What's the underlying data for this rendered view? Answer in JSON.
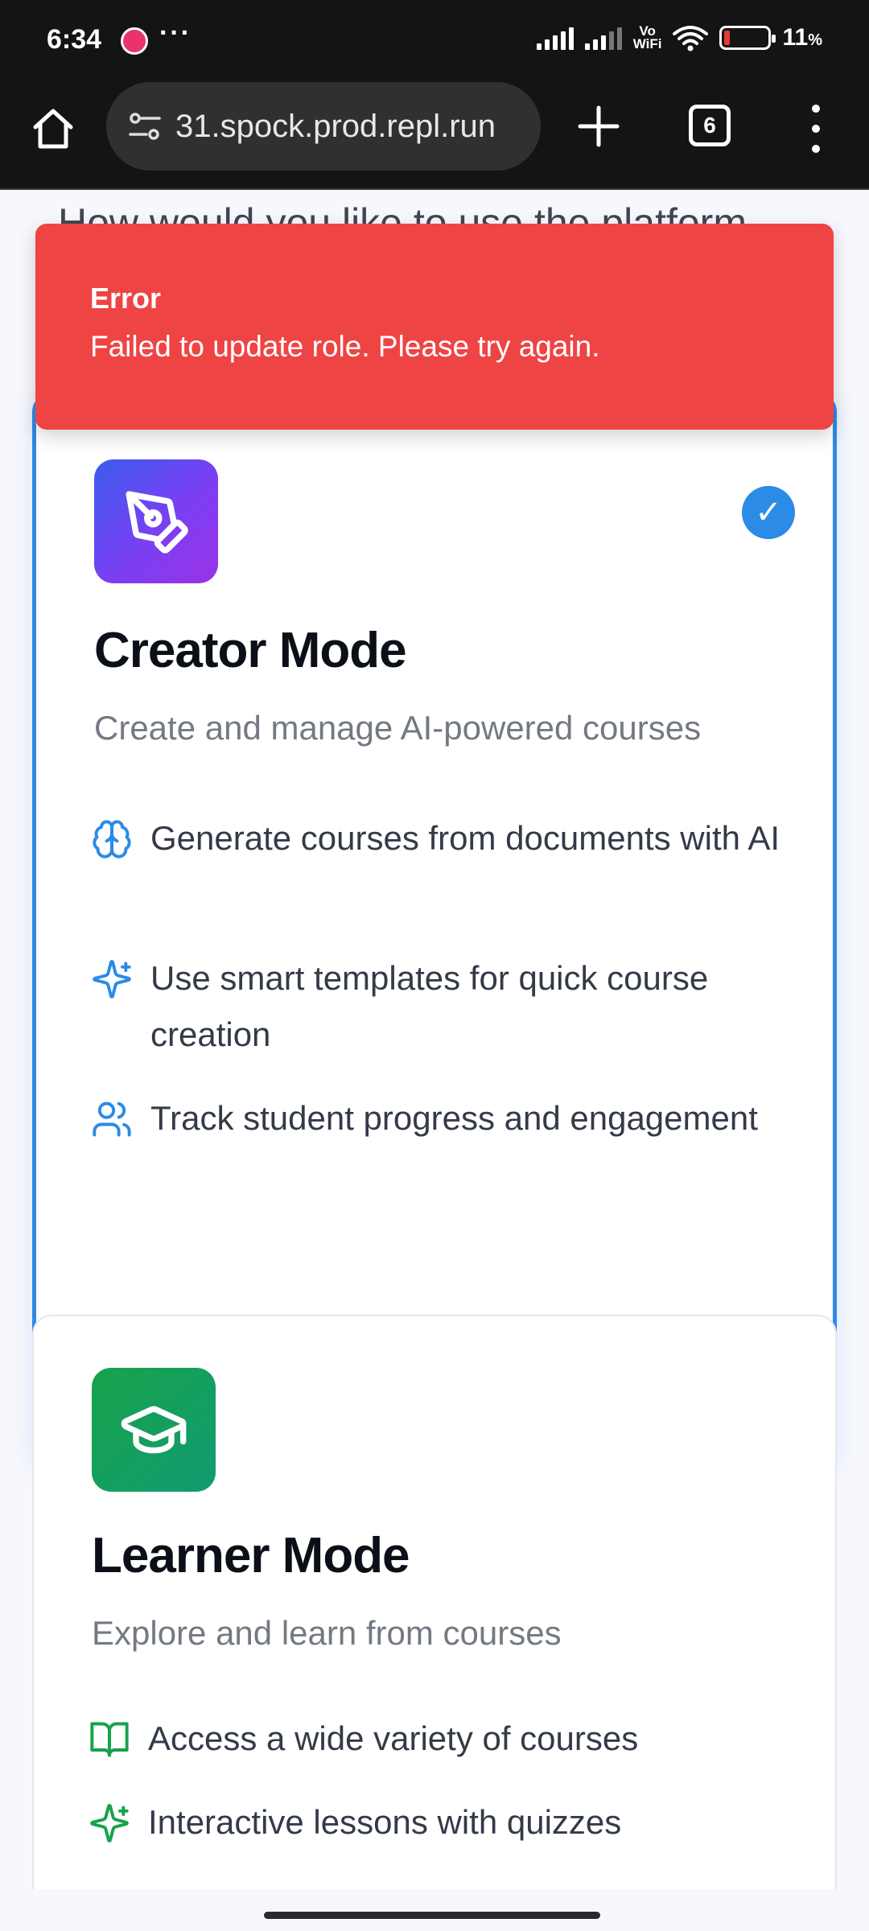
{
  "status_bar": {
    "time": "6:34",
    "dots": "···",
    "vowifi_line1": "Vo",
    "vowifi_line2": "WiFi",
    "battery_percent": "11",
    "battery_unit": "%"
  },
  "browser": {
    "url": "31.spock.prod.repl.run",
    "tab_count": "6"
  },
  "page": {
    "heading": "How would you like to use the platform"
  },
  "toast": {
    "title": "Error",
    "message": "Failed to update role. Please try again.",
    "color": "#ef4444"
  },
  "creator": {
    "title": "Creator Mode",
    "subtitle": "Create and manage AI-powered courses",
    "selected": true,
    "features": [
      {
        "icon": "brain-icon",
        "text": "Generate courses from documents with AI"
      },
      {
        "icon": "sparkles-icon",
        "text": "Use smart templates for quick course creation"
      },
      {
        "icon": "users-icon",
        "text": "Track student progress and engagement"
      }
    ],
    "check": "✓",
    "accent": "#2b8be6"
  },
  "learner": {
    "title": "Learner Mode",
    "subtitle": "Explore and learn from courses",
    "features": [
      {
        "icon": "book-open-icon",
        "text": "Access a wide variety of courses"
      },
      {
        "icon": "sparkles-icon",
        "text": "Interactive lessons with quizzes"
      }
    ],
    "accent": "#16a34a"
  }
}
